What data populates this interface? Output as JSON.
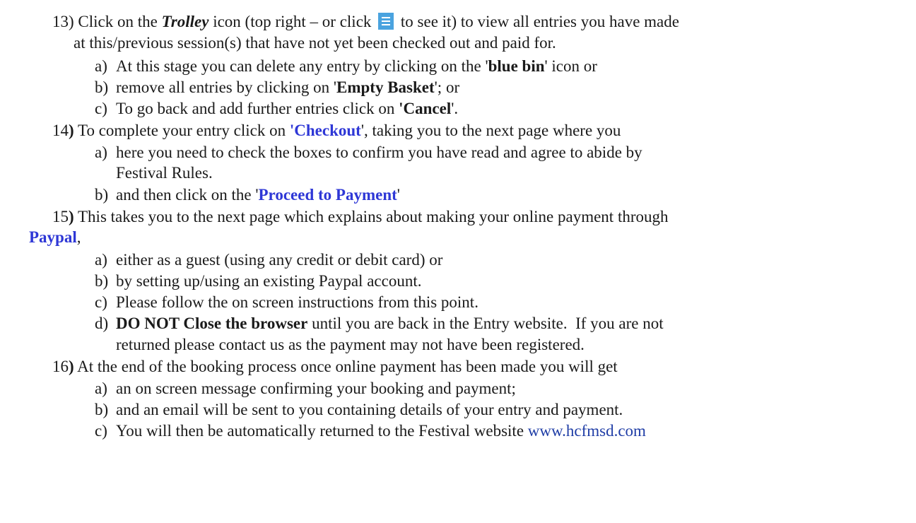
{
  "s13": {
    "num": "13)",
    "t1": " Click on the ",
    "trolley": "Trolley",
    "t2": " icon (top right – or click ",
    "t3": " to see it) to view all entries you have made",
    "l2": "at this/previous session(s) that have not yet been checked out and paid for.",
    "a_label": "a)",
    "a1": "At this stage you can delete any entry by clicking on the '",
    "a_bold": "blue bin",
    "a2": "' icon or",
    "b_label": "b)",
    "b1": "remove all entries by clicking on '",
    "b_bold": "Empty Basket",
    "b2": "'; or",
    "c_label": "c)",
    "c1": "To go back and add further entries click on ",
    "c_bold": "'Cancel",
    "c2": "'."
  },
  "s14": {
    "num": "14",
    "paren": ")",
    "t1": " To complete your entry click on ",
    "checkout": "'Checkout",
    "t2": "', taking you to the next page where you",
    "a_label": "a)",
    "a1": "here you need to check the boxes to confirm you have read and agree to abide by",
    "a2": "Festival Rules.",
    "b_label": "b)",
    "b1": "and then click on the '",
    "b_blue": "Proceed to Payment",
    "b2": "'"
  },
  "s15": {
    "num": "15",
    "paren": ")",
    "t1": " This takes you to the next page which explains about making your online payment through",
    "paypal": "Paypal",
    "comma": ",",
    "a_label": "a)",
    "a1": "either as a guest (using any credit or debit card) or",
    "b_label": "b)",
    "b1": "by setting up/using an existing Paypal account.",
    "c_label": "c)",
    "c1": "Please follow the on screen instructions from this point.",
    "d_label": "d)",
    "d_bold": "DO NOT Close the browser",
    "d1": " until you are back in the Entry website.  If you are not",
    "d2": "returned please contact us as the payment may not have been registered."
  },
  "s16": {
    "num": "16",
    "paren": ")",
    "t1": " At the end of the booking process once online payment has been made you will get",
    "a_label": "a)",
    "a1": "an on screen message confirming your booking and payment;",
    "b_label": "b)",
    "b1": "and an email will be sent to you containing details of your entry and payment.",
    "c_label": "c)",
    "c1": "You will then be automatically returned to the Festival website ",
    "c_link": "www.hcfmsd.com"
  }
}
